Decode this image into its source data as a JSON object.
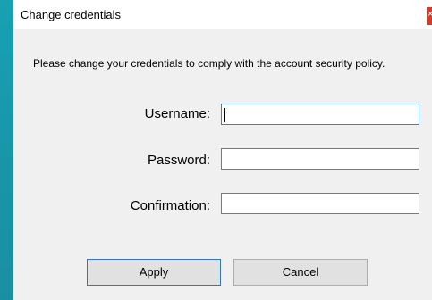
{
  "window": {
    "title": "Change credentials",
    "close_glyph": "×"
  },
  "message": "Please change your credentials to comply with the account security policy.",
  "form": {
    "username_label": "Username:",
    "username_value": "",
    "password_label": "Password:",
    "password_value": "",
    "confirmation_label": "Confirmation:",
    "confirmation_value": ""
  },
  "buttons": {
    "apply_label": "Apply",
    "cancel_label": "Cancel"
  },
  "colors": {
    "desktop": "#1b9bad",
    "dialog": "#f0f0f0",
    "focus_border": "#3f7fc4",
    "close_button": "#d33b2c"
  }
}
